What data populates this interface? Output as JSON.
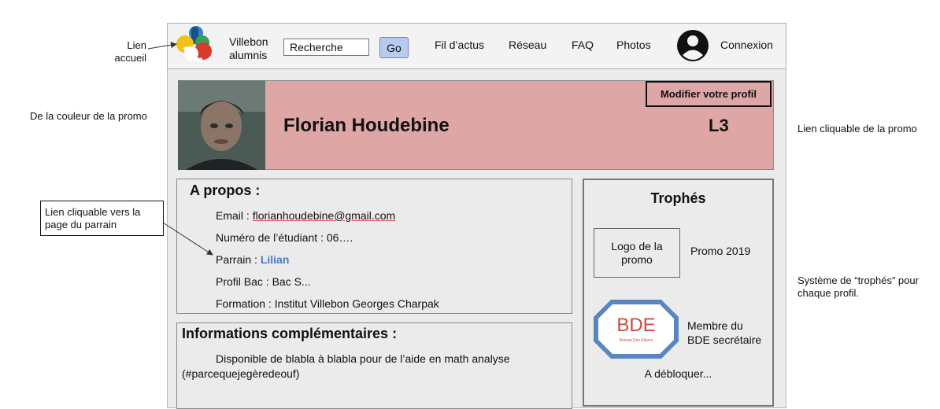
{
  "annotations": {
    "home_link": "Lien\naccueil",
    "promo_color": "De la couleur de la promo",
    "promo_link": "Lien cliquable de la promo",
    "sponsor_link": "Lien cliquable vers la\npage du parrain",
    "trophy_system": "Système de “trophés” pour\nchaque profil."
  },
  "header": {
    "brand_line1": "Villebon",
    "brand_line2": "alumnis",
    "search_placeholder": "Recherche",
    "go_label": "Go",
    "nav": [
      "Fil d’actus",
      "Réseau",
      "FAQ",
      "Photos"
    ],
    "login_label": "Connexion"
  },
  "profile": {
    "name": "Florian Houdebine",
    "promo": "L3",
    "edit_label": "Modifier votre profil"
  },
  "about": {
    "title": "A propos :",
    "email_label": "Email : ",
    "email_value": "florianhoudebine@gmail.com",
    "student_number": "Numéro de l’étudiant : 06….",
    "sponsor_label": "Parrain : ",
    "sponsor_value": "Lilian",
    "bac_profile": "Profil Bac : Bac S...",
    "formation": "Formation : Institut Villebon Georges Charpak"
  },
  "extra": {
    "title": "Informations complémentaires :",
    "text_line1": "Disponible de blabla à blabla pour de l’aide en math analyse",
    "text_line2": "(#parcequejegèredeouf)"
  },
  "trophies": {
    "title": "Trophés",
    "logo_placeholder": "Logo de la\npromo",
    "promo_trophy": "Promo 2019",
    "bde_logo_text": "BDE",
    "bde_logo_sub": "Bureau Des Elèves",
    "bde_trophy": "Membre du\nBDE secrétaire",
    "locked_text": "A débloquer..."
  },
  "colors": {
    "banner": "#dfa6a6",
    "link_blue": "#4a78c9",
    "go_button": "#b7cbef"
  }
}
